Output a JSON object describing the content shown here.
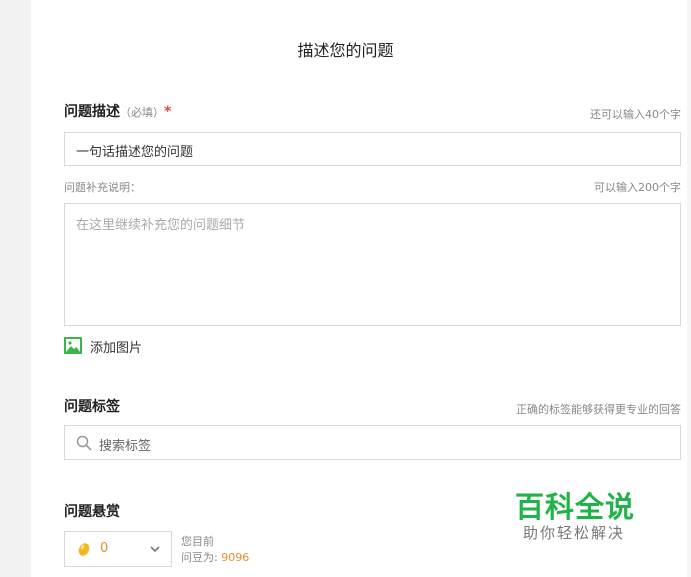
{
  "page_title": "描述您的问题",
  "description": {
    "label": "问题描述",
    "required_note": "（必填）",
    "required_mark": "*",
    "limit_hint": "还可以输入40个字",
    "value": "一句话描述您的问题"
  },
  "supplement": {
    "label": "问题补充说明：",
    "limit_hint": "可以输入200个字",
    "placeholder": "在这里继续补充您的问题细节"
  },
  "add_image": {
    "label": "添加图片",
    "icon": "image-icon"
  },
  "tags": {
    "label": "问题标签",
    "hint": "正确的标签能够获得更专业的回答",
    "search_placeholder": "搜索标签",
    "icon": "search-icon"
  },
  "reward": {
    "label": "问题悬赏",
    "selected_value": "0",
    "balance_line1": "您目前",
    "balance_prefix": "问豆为: ",
    "balance_value": "9096",
    "icon": "bean-icon"
  },
  "watermark": {
    "title": "百科全说",
    "subtitle": "助你轻松解决"
  },
  "colors": {
    "required": "#e64340",
    "accent_orange": "#f08b2a",
    "image_icon_green": "#3bb54a",
    "watermark_green": "#20b34a"
  }
}
